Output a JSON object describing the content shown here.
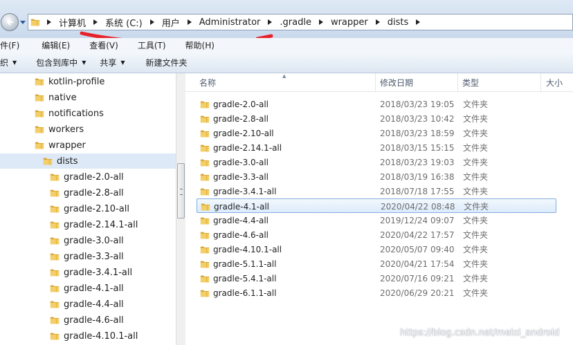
{
  "address_bar": {
    "segments": [
      "计算机",
      "系统 (C:)",
      "用户",
      "Administrator",
      ".gradle",
      "wrapper",
      "dists"
    ]
  },
  "menu": {
    "items": [
      "件(F)",
      "编辑(E)",
      "查看(V)",
      "工具(T)",
      "帮助(H)"
    ]
  },
  "toolbar": {
    "organize": "织",
    "include_library": "包含到库中",
    "share": "共享",
    "new_folder": "新建文件夹"
  },
  "nav_tree": {
    "items": [
      {
        "label": "kotlin-profile",
        "level": 1
      },
      {
        "label": "native",
        "level": 1
      },
      {
        "label": "notifications",
        "level": 1
      },
      {
        "label": "workers",
        "level": 1
      },
      {
        "label": "wrapper",
        "level": 1
      },
      {
        "label": "dists",
        "level": 2,
        "selected": true
      },
      {
        "label": "gradle-2.0-all",
        "level": 3
      },
      {
        "label": "gradle-2.8-all",
        "level": 3
      },
      {
        "label": "gradle-2.10-all",
        "level": 3
      },
      {
        "label": "gradle-2.14.1-all",
        "level": 3
      },
      {
        "label": "gradle-3.0-all",
        "level": 3
      },
      {
        "label": "gradle-3.3-all",
        "level": 3
      },
      {
        "label": "gradle-3.4.1-all",
        "level": 3
      },
      {
        "label": "gradle-4.1-all",
        "level": 3
      },
      {
        "label": "gradle-4.4-all",
        "level": 3
      },
      {
        "label": "gradle-4.6-all",
        "level": 3
      },
      {
        "label": "gradle-4.10.1-all",
        "level": 3
      }
    ]
  },
  "columns": {
    "name": "名称",
    "date": "修改日期",
    "type": "类型",
    "size": "大小"
  },
  "files": [
    {
      "name": "gradle-2.0-all",
      "date": "2018/03/23 19:05",
      "type": "文件夹"
    },
    {
      "name": "gradle-2.8-all",
      "date": "2018/03/23 10:42",
      "type": "文件夹"
    },
    {
      "name": "gradle-2.10-all",
      "date": "2018/03/23 18:59",
      "type": "文件夹"
    },
    {
      "name": "gradle-2.14.1-all",
      "date": "2018/03/15 15:15",
      "type": "文件夹"
    },
    {
      "name": "gradle-3.0-all",
      "date": "2018/03/23 19:03",
      "type": "文件夹"
    },
    {
      "name": "gradle-3.3-all",
      "date": "2018/03/19 16:38",
      "type": "文件夹"
    },
    {
      "name": "gradle-3.4.1-all",
      "date": "2018/07/18 17:55",
      "type": "文件夹"
    },
    {
      "name": "gradle-4.1-all",
      "date": "2020/04/22 08:48",
      "type": "文件夹",
      "selected": true
    },
    {
      "name": "gradle-4.4-all",
      "date": "2019/12/24 09:07",
      "type": "文件夹"
    },
    {
      "name": "gradle-4.6-all",
      "date": "2020/04/22 17:57",
      "type": "文件夹"
    },
    {
      "name": "gradle-4.10.1-all",
      "date": "2020/05/07 09:40",
      "type": "文件夹"
    },
    {
      "name": "gradle-5.1.1-all",
      "date": "2020/04/21 17:54",
      "type": "文件夹"
    },
    {
      "name": "gradle-5.4.1-all",
      "date": "2020/07/16 09:21",
      "type": "文件夹"
    },
    {
      "name": "gradle-6.1.1-all",
      "date": "2020/06/29 20:21",
      "type": "文件夹"
    }
  ],
  "watermark": "https://blog.csdn.net/meixi_android",
  "colors": {
    "annotation": "#e8202a",
    "selection_border": "#84acdd",
    "folder": "#e8b93e"
  }
}
